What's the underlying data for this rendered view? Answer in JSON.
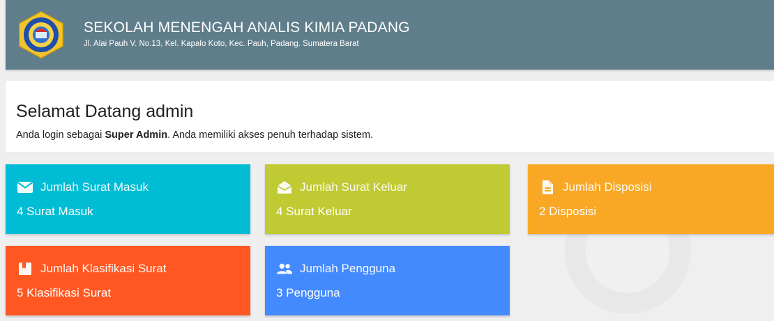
{
  "header": {
    "school_name": "SEKOLAH MENENGAH ANALIS KIMIA PADANG",
    "address": "Jl. Alai Pauh V. No.13, Kel. Kapalo Koto, Kec. Pauh, Padang. Sumatera Barat",
    "logo_icon": "school-emblem-icon",
    "logo_text_top": "SEKOLAH MENENGAH ANALIS KIMIA",
    "logo_text_bottom": "PADANG"
  },
  "welcome": {
    "title": "Selamat Datang admin",
    "text_prefix": "Anda login sebagai ",
    "role": "Super Admin",
    "text_suffix": ". Anda memiliki akses penuh terhadap sistem."
  },
  "cards": [
    {
      "icon": "envelope-icon",
      "title": "Jumlah Surat Masuk",
      "value": "4 Surat Masuk",
      "color": "#00bcd4"
    },
    {
      "icon": "envelope-open-icon",
      "title": "Jumlah Surat Keluar",
      "value": "4 Surat Keluar",
      "color": "#c0ca33"
    },
    {
      "icon": "document-icon",
      "title": "Jumlah Disposisi",
      "value": "2 Disposisi",
      "color": "#f9a825"
    },
    {
      "icon": "bookmark-icon",
      "title": "Jumlah Klasifikasi Surat",
      "value": "5 Klasifikasi Surat",
      "color": "#ff5722"
    },
    {
      "icon": "people-icon",
      "title": "Jumlah Pengguna",
      "value": "3 Pengguna",
      "color": "#448aff"
    }
  ],
  "colors": {
    "header_bg": "#5f7d8a",
    "page_bg": "#efefef"
  }
}
